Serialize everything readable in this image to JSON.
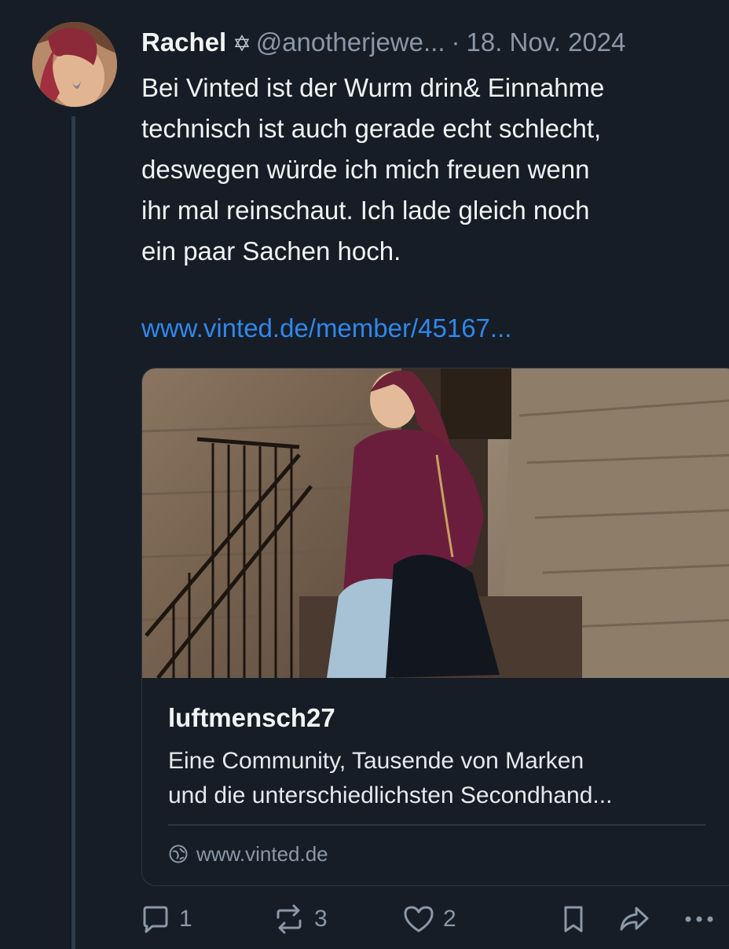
{
  "post": {
    "author_name": "Rachel",
    "author_emoji": "✡",
    "handle": "@anotherjewe...",
    "separator": "·",
    "date": "18. Nov. 2024",
    "text_lines": [
      "Bei Vinted ist der Wurm drin& Einnahme",
      "technisch ist auch gerade echt schlecht,",
      "deswegen würde ich mich freuen wenn",
      "ihr mal reinschaut. Ich lade gleich noch",
      "ein paar Sachen hoch."
    ],
    "link": "www.vinted.de/member/45167..."
  },
  "link_card": {
    "title": "luftmensch27",
    "description_lines": [
      "Eine Community, Tausende von Marken",
      "und die unterschiedlichsten Secondhand..."
    ],
    "domain": "www.vinted.de",
    "domain_icon": "globe-icon"
  },
  "actions": {
    "reply_count": "1",
    "repost_count": "3",
    "like_count": "2",
    "icons": [
      "reply-icon",
      "repost-icon",
      "like-icon",
      "bookmark-icon",
      "share-icon",
      "more-icon"
    ]
  },
  "colors": {
    "background": "#161d26",
    "link": "#2f87ec",
    "muted": "#8b98a8",
    "border": "#2b3744"
  }
}
